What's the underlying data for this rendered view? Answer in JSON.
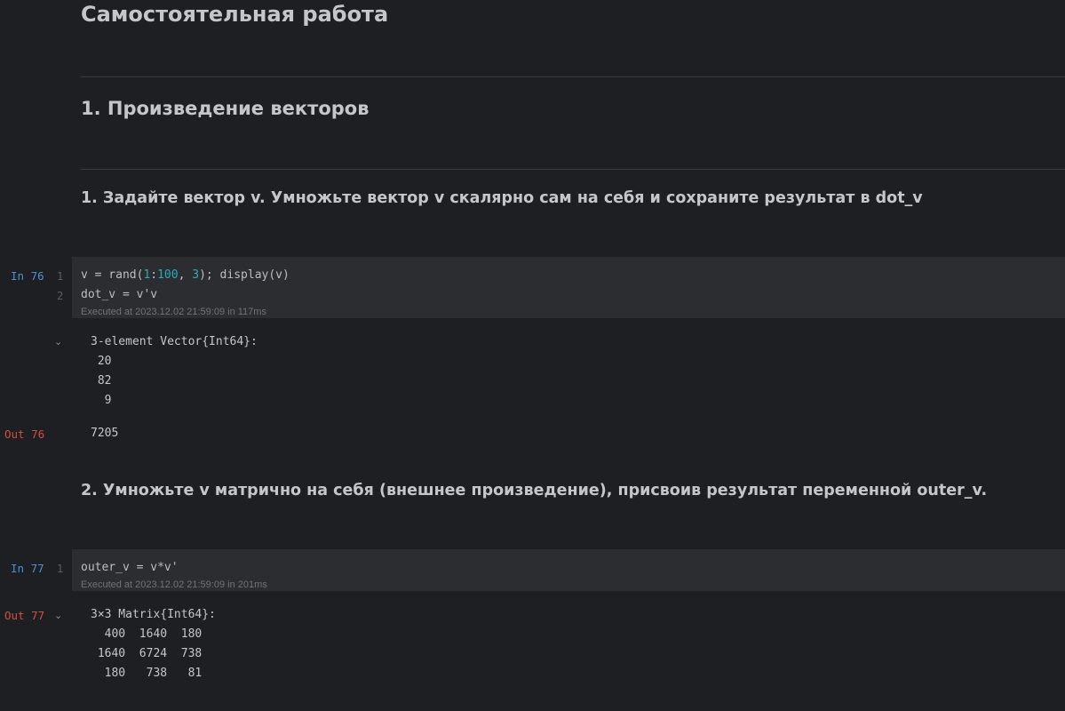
{
  "headings": {
    "title": "Самостоятельная работа",
    "section": "1. Произведение векторов",
    "task1": "1. Задайте вектор v. Умножьте вектор v скалярно сам на себя и сохраните результат в dot_v",
    "task2": "2. Умножьте v матрично на себя (внешнее произведение), присвоив результат переменной outer_v."
  },
  "cell76": {
    "in_label": "In 76",
    "line_numbers": [
      "1",
      "2"
    ],
    "line1": {
      "p1": "v = rand(",
      "n1": "1",
      "p2": ":",
      "n2": "100",
      "p3": ", ",
      "n3": "3",
      "p4": "); display(v)"
    },
    "line2": "dot_v = v'v",
    "executed": "Executed at 2023.12.02 21:59:09 in 117ms",
    "display_output": [
      "3-element Vector{Int64}:",
      " 20",
      " 82",
      "  9"
    ],
    "out_label": "Out 76",
    "out_value": "7205"
  },
  "cell77": {
    "in_label": "In 77",
    "line_numbers": [
      "1"
    ],
    "line1": "outer_v = v*v'",
    "executed": "Executed at 2023.12.02 21:59:09 in 201ms",
    "out_label": "Out 77",
    "output": [
      "3×3 Matrix{Int64}:",
      "  400  1640  180",
      " 1640  6724  738",
      "  180   738   81"
    ]
  },
  "icons": {
    "collapse": "chevron-down-icon"
  }
}
